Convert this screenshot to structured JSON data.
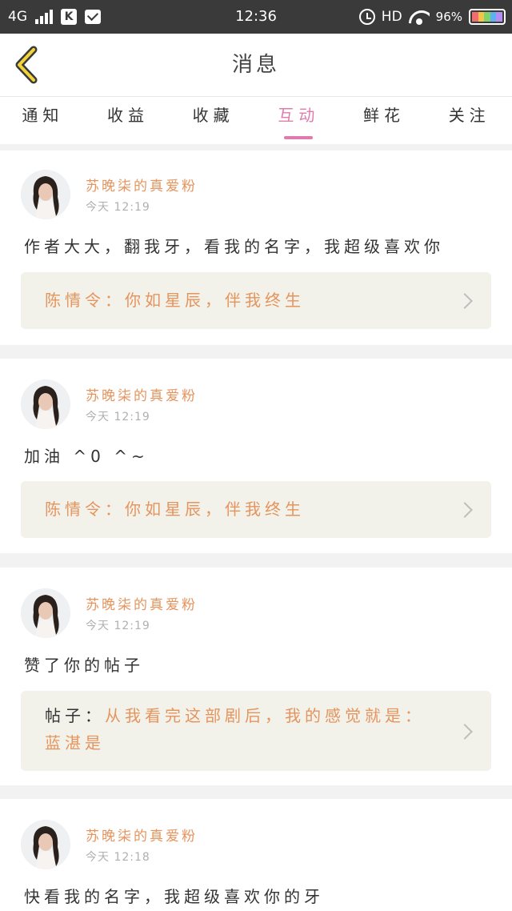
{
  "status_bar": {
    "network": "4G",
    "app_badge": "K",
    "time": "12:36",
    "hd": "HD",
    "battery": "96%"
  },
  "header": {
    "title": "消息"
  },
  "tabs": [
    {
      "label": "通知"
    },
    {
      "label": "收益"
    },
    {
      "label": "收藏"
    },
    {
      "label": "互动",
      "active": true
    },
    {
      "label": "鲜花"
    },
    {
      "label": "关注"
    }
  ],
  "messages": [
    {
      "username": "苏晚柒的真爱粉",
      "time": "今天 12:19",
      "text": "作者大大，翻我牙，看我的名字，我超级喜欢你",
      "quote_prefix": "",
      "quote": "陈情令：你如星辰，伴我终生"
    },
    {
      "username": "苏晚柒的真爱粉",
      "time": "今天 12:19",
      "text": "加油 ^0 ^~",
      "quote_prefix": "",
      "quote": "陈情令：你如星辰，伴我终生"
    },
    {
      "username": "苏晚柒的真爱粉",
      "time": "今天 12:19",
      "text": "赞了你的帖子",
      "quote_prefix": "帖子：",
      "quote": "从我看完这部剧后，我的感觉就是：蓝湛是"
    },
    {
      "username": "苏晚柒的真爱粉",
      "time": "今天 12:18",
      "text": "快看我的名字，我超级喜欢你的牙",
      "quote_prefix": "",
      "quote": ""
    }
  ],
  "colors": {
    "accent_pink": "#e07bae",
    "accent_orange": "#e5945e",
    "back_arrow": "#f2d33a"
  }
}
